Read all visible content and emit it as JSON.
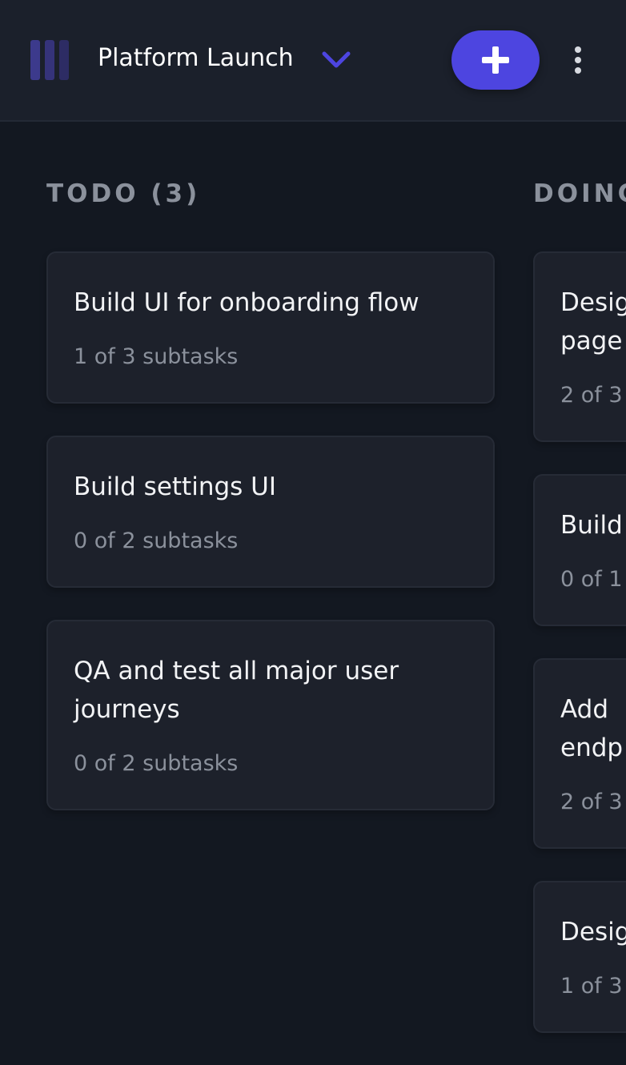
{
  "colors": {
    "accent": "#4d45e0",
    "logo_bar_1": "#3c3a8c",
    "logo_bar_2": "#35337a",
    "logo_bar_3": "#2d2c64"
  },
  "header": {
    "logo_icon": "board-logo-icon",
    "board_title": "Platform Launch",
    "board_select_icon": "chevron-down-icon",
    "add_task_icon": "plus-icon",
    "more_icon": "vertical-dots-icon"
  },
  "columns": [
    {
      "title": "TODO (3)",
      "cards": [
        {
          "title_lines": [
            "Build UI for onboarding flow"
          ],
          "subtasks": "1 of 3 subtasks"
        },
        {
          "title_lines": [
            "Build settings UI"
          ],
          "subtasks": "0 of 2 subtasks"
        },
        {
          "title_lines": [
            "QA and test all major user",
            "journeys"
          ],
          "subtasks": "0 of 2 subtasks"
        }
      ]
    },
    {
      "title": "DOING",
      "cards": [
        {
          "title_lines": [
            "Desig",
            "page"
          ],
          "subtasks": "2 of 3"
        },
        {
          "title_lines": [
            "Build"
          ],
          "subtasks": "0 of 1"
        },
        {
          "title_lines": [
            "Add",
            "endp"
          ],
          "subtasks": "2 of 3"
        },
        {
          "title_lines": [
            "Desig"
          ],
          "subtasks": "1 of 3"
        }
      ]
    }
  ]
}
